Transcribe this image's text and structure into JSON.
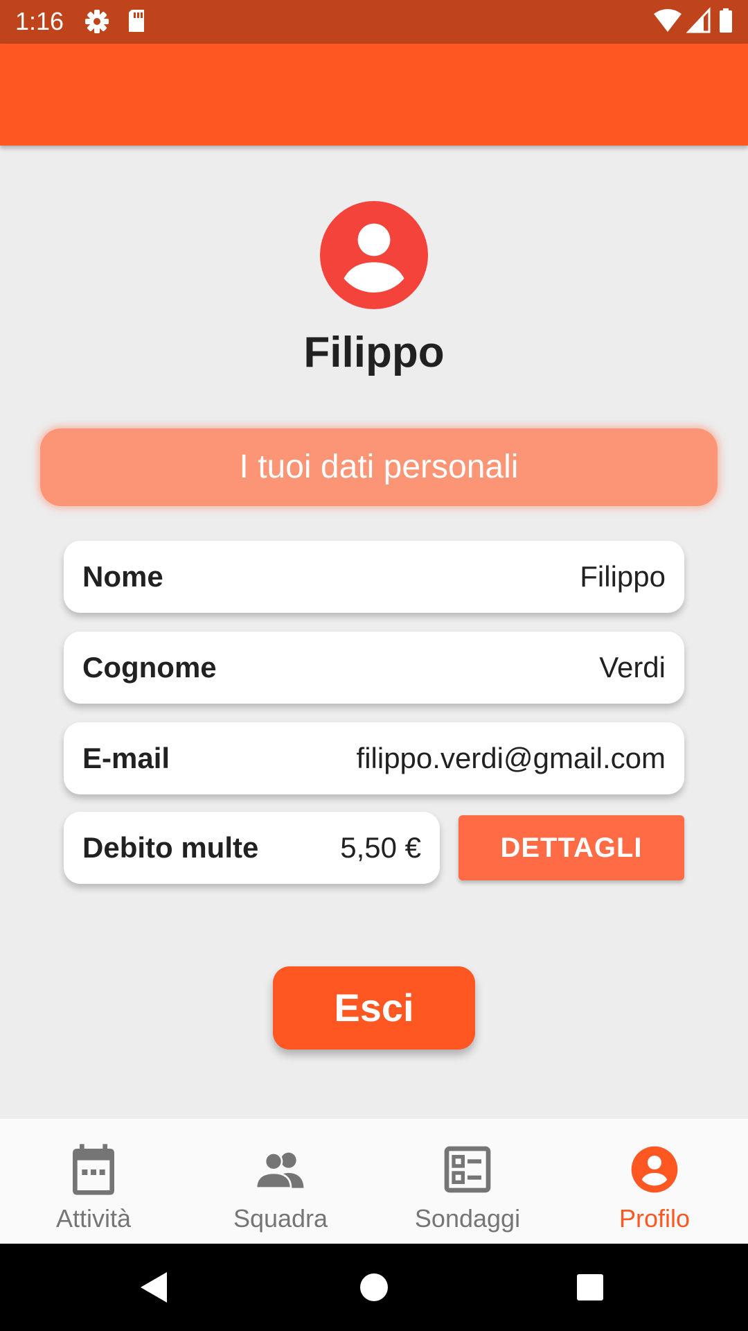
{
  "status_bar": {
    "time": "1:16",
    "icons": [
      "settings-icon",
      "sd-card-icon",
      "wifi-icon",
      "signal-icon",
      "battery-icon"
    ],
    "color": "#BF441C"
  },
  "app_bar": {
    "color": "#FF5722"
  },
  "profile": {
    "avatar_icon": "account-circle-icon",
    "avatar_color": "#F4433A",
    "name": "Filippo"
  },
  "section": {
    "title": "I tuoi dati personali",
    "color": "#FC9576"
  },
  "fields": {
    "nome": {
      "label": "Nome",
      "value": "Filippo"
    },
    "cognome": {
      "label": "Cognome",
      "value": "Verdi"
    },
    "email": {
      "label": "E-mail",
      "value": "filippo.verdi@gmail.com"
    },
    "debito": {
      "label": "Debito multe",
      "value": "5,50 €"
    }
  },
  "buttons": {
    "details_label": "DETTAGLI",
    "logout_label": "Esci"
  },
  "bottom_nav": {
    "items": [
      {
        "label": "Attività",
        "icon": "calendar-icon",
        "active": false
      },
      {
        "label": "Squadra",
        "icon": "group-icon",
        "active": false
      },
      {
        "label": "Sondaggi",
        "icon": "poll-icon",
        "active": false
      },
      {
        "label": "Profilo",
        "icon": "account-circle-icon",
        "active": true
      }
    ],
    "active_color": "#FF5722",
    "inactive_color": "#757575"
  },
  "system_nav": {
    "icons": [
      "back-icon",
      "home-icon",
      "recents-icon"
    ]
  }
}
